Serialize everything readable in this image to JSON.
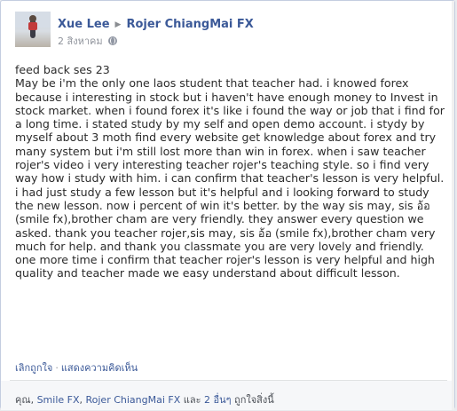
{
  "post": {
    "author": "Xue Lee",
    "target": "Rojer ChiangMai FX",
    "timestamp": "2 สิงหาคม",
    "title_line": "feed back ses 23",
    "body": "May be i'm the only one laos student that teacher had. i knowed forex because i interesting in stock but i haven't have enough money to Invest in stock market. when i found forex it's like i found the way or job that i find for a long time. i stated study by my self and open demo account. i stydy by myself about 3 moth find every website get knowledge about forex and try many system but i'm still lost more than win in forex. when i saw teacher rojer's video i very interesting teacher rojer's teaching style. so i find very way how i study with him. i can confirm that teacher's lesson is very helpful. i had just study a few lesson but it's helpful and i looking forward to study the new lesson. now i percent of win it's better. by the way sis may, sis อ้อ (smile fx),brother cham are very friendly. they answer every question we asked. thank you teacher rojer,sis may, sis อ้อ (smile fx),brother cham very much for help. and thank you classmate you are very lovely and friendly. one more time i confirm that teacher rojer's lesson is very helpful and high quality and teacher made we easy understand about difficult lesson."
  },
  "actions": {
    "unlike_label": "เลิกถูกใจ",
    "separator": "·",
    "comment_label": "แสดงความคิดเห็น"
  },
  "likes": {
    "you": "คุณ, ",
    "person1": "Smile FX",
    "comma": ", ",
    "person2": "Rojer ChiangMai FX",
    "and_text": " และ ",
    "others": "2 อื่นๆ",
    "suffix": " ถูกใจสิ่งนี้"
  },
  "icons": {
    "arrow": "arrow-right-icon",
    "privacy": "globe-icon"
  },
  "colors": {
    "link": "#3b5998",
    "text": "#2b2b2b",
    "muted": "#90949c",
    "likes_bg": "#f6f7f9"
  }
}
